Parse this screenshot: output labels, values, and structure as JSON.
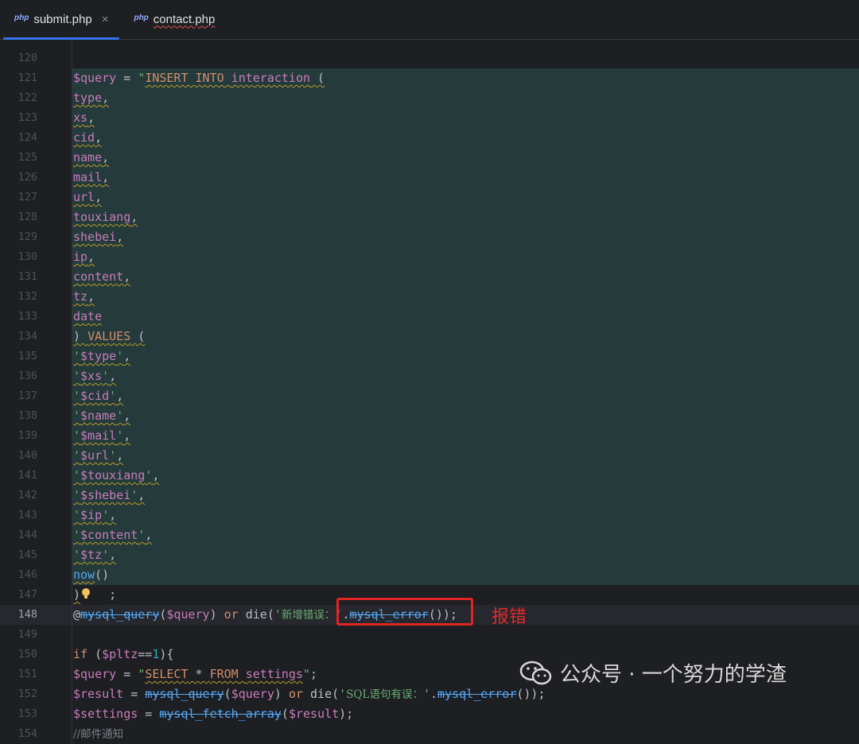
{
  "tabs": [
    {
      "icon_text": "php",
      "label": "submit.php",
      "active": true,
      "close": "×"
    },
    {
      "icon_text": "php",
      "label": "contact.php",
      "active": false
    }
  ],
  "lines": [
    {
      "n": "120",
      "tokens": []
    },
    {
      "n": "121",
      "tokens": [
        [
          "var",
          "$query"
        ],
        [
          "plain",
          " = "
        ],
        [
          "str",
          "\""
        ],
        [
          "sqlkw sq",
          "INSERT INTO"
        ],
        [
          "plain sq",
          " "
        ],
        [
          "sqlid sq",
          "interaction"
        ],
        [
          "plain sq",
          " ("
        ]
      ]
    },
    {
      "n": "122",
      "tokens": [
        [
          "sqlid sq",
          "type"
        ],
        [
          "plain sq",
          ","
        ]
      ]
    },
    {
      "n": "123",
      "tokens": [
        [
          "sqlid sq",
          "xs"
        ],
        [
          "plain sq",
          ","
        ]
      ]
    },
    {
      "n": "124",
      "tokens": [
        [
          "sqlid sq",
          "cid"
        ],
        [
          "plain sq",
          ","
        ]
      ]
    },
    {
      "n": "125",
      "tokens": [
        [
          "sqlid sq",
          "name"
        ],
        [
          "plain sq",
          ","
        ]
      ]
    },
    {
      "n": "126",
      "tokens": [
        [
          "sqlid sq",
          "mail"
        ],
        [
          "plain sq",
          ","
        ]
      ]
    },
    {
      "n": "127",
      "tokens": [
        [
          "sqlid sq",
          "url"
        ],
        [
          "plain sq",
          ","
        ]
      ]
    },
    {
      "n": "128",
      "tokens": [
        [
          "sqlid sq",
          "touxiang"
        ],
        [
          "plain sq",
          ","
        ]
      ]
    },
    {
      "n": "129",
      "tokens": [
        [
          "sqlid sq",
          "shebei"
        ],
        [
          "plain sq",
          ","
        ]
      ]
    },
    {
      "n": "130",
      "tokens": [
        [
          "sqlid sq",
          "ip"
        ],
        [
          "plain sq",
          ","
        ]
      ]
    },
    {
      "n": "131",
      "tokens": [
        [
          "sqlid sq",
          "content"
        ],
        [
          "plain sq",
          ","
        ]
      ]
    },
    {
      "n": "132",
      "tokens": [
        [
          "sqlid sq",
          "tz"
        ],
        [
          "plain sq",
          ","
        ]
      ]
    },
    {
      "n": "133",
      "tokens": [
        [
          "sqlid sq",
          "date"
        ]
      ]
    },
    {
      "n": "134",
      "tokens": [
        [
          "plain sq",
          ") "
        ],
        [
          "sqlkw sq",
          "VALUES"
        ],
        [
          "plain sq",
          " ("
        ]
      ]
    },
    {
      "n": "135",
      "tokens": [
        [
          "str sq",
          "'"
        ],
        [
          "var sq",
          "$type"
        ],
        [
          "str sq",
          "'"
        ],
        [
          "plain sq",
          ","
        ]
      ]
    },
    {
      "n": "136",
      "tokens": [
        [
          "str sq",
          "'"
        ],
        [
          "var sq",
          "$xs"
        ],
        [
          "str sq",
          "'"
        ],
        [
          "plain sq",
          ","
        ]
      ]
    },
    {
      "n": "137",
      "tokens": [
        [
          "str sq",
          "'"
        ],
        [
          "var sq",
          "$cid"
        ],
        [
          "str sq",
          "'"
        ],
        [
          "plain sq",
          ","
        ]
      ]
    },
    {
      "n": "138",
      "tokens": [
        [
          "str sq",
          "'"
        ],
        [
          "var sq",
          "$name"
        ],
        [
          "str sq",
          "'"
        ],
        [
          "plain sq",
          ","
        ]
      ]
    },
    {
      "n": "139",
      "tokens": [
        [
          "str sq",
          "'"
        ],
        [
          "var sq",
          "$mail"
        ],
        [
          "str sq",
          "'"
        ],
        [
          "plain sq",
          ","
        ]
      ]
    },
    {
      "n": "140",
      "tokens": [
        [
          "str sq",
          "'"
        ],
        [
          "var sq",
          "$url"
        ],
        [
          "str sq",
          "'"
        ],
        [
          "plain sq",
          ","
        ]
      ]
    },
    {
      "n": "141",
      "tokens": [
        [
          "str sq",
          "'"
        ],
        [
          "var sq",
          "$touxiang"
        ],
        [
          "str sq",
          "'"
        ],
        [
          "plain sq",
          ","
        ]
      ]
    },
    {
      "n": "142",
      "tokens": [
        [
          "str sq",
          "'"
        ],
        [
          "var sq",
          "$shebei"
        ],
        [
          "str sq",
          "'"
        ],
        [
          "plain sq",
          ","
        ]
      ]
    },
    {
      "n": "143",
      "tokens": [
        [
          "str sq",
          "'"
        ],
        [
          "var sq",
          "$ip"
        ],
        [
          "str sq",
          "'"
        ],
        [
          "plain sq",
          ","
        ]
      ]
    },
    {
      "n": "144",
      "tokens": [
        [
          "str sq",
          "'"
        ],
        [
          "var sq",
          "$content"
        ],
        [
          "str sq",
          "'"
        ],
        [
          "plain sq",
          ","
        ]
      ]
    },
    {
      "n": "145",
      "tokens": [
        [
          "str sq",
          "'"
        ],
        [
          "var sq",
          "$tz"
        ],
        [
          "str sq",
          "'"
        ],
        [
          "plain sq",
          ","
        ]
      ]
    },
    {
      "n": "146",
      "tokens": [
        [
          "fn sq",
          "now"
        ],
        [
          "plain",
          "()"
        ]
      ]
    },
    {
      "n": "147",
      "tokens": [
        [
          "plain sq",
          ")"
        ],
        [
          "plain",
          "    ;"
        ]
      ]
    },
    {
      "n": "148",
      "tokens": [
        [
          "plain",
          "@"
        ],
        [
          "fn-dep",
          "mysql_query"
        ],
        [
          "plain",
          "("
        ],
        [
          "var",
          "$query"
        ],
        [
          "plain",
          ") "
        ],
        [
          "kw",
          "or"
        ],
        [
          "plain",
          " die("
        ],
        [
          "str",
          "'"
        ],
        [
          "str cjk",
          "新增错误："
        ],
        [
          "str",
          "'"
        ],
        [
          "plain",
          "."
        ],
        [
          "fn-dep",
          "mysql_error"
        ],
        [
          "plain",
          "());"
        ]
      ]
    },
    {
      "n": "149",
      "tokens": []
    },
    {
      "n": "150",
      "tokens": [
        [
          "kw",
          "if"
        ],
        [
          "plain",
          " ("
        ],
        [
          "var",
          "$pltz"
        ],
        [
          "plain",
          "=="
        ],
        [
          "num",
          "1"
        ],
        [
          "plain",
          "){"
        ]
      ]
    },
    {
      "n": "151",
      "tokens": [
        [
          "var",
          "$query"
        ],
        [
          "plain",
          " = "
        ],
        [
          "str",
          "\""
        ],
        [
          "sqlkw sq",
          "SELECT"
        ],
        [
          "plain sq",
          " * "
        ],
        [
          "sqlkw sq",
          "FROM"
        ],
        [
          "plain sq",
          " "
        ],
        [
          "sqlid sq",
          "settings"
        ],
        [
          "str",
          "\""
        ],
        [
          "plain",
          ";"
        ]
      ]
    },
    {
      "n": "152",
      "tokens": [
        [
          "var",
          "$result"
        ],
        [
          "plain",
          " = "
        ],
        [
          "fn-dep",
          "mysql_query"
        ],
        [
          "plain",
          "("
        ],
        [
          "var",
          "$query"
        ],
        [
          "plain",
          ") "
        ],
        [
          "kw",
          "or"
        ],
        [
          "plain",
          " die("
        ],
        [
          "str",
          "'"
        ],
        [
          "str cjk",
          "SQL语句有误："
        ],
        [
          "str",
          "'"
        ],
        [
          "plain",
          "."
        ],
        [
          "fn-dep",
          "mysql_error"
        ],
        [
          "plain",
          "());"
        ]
      ]
    },
    {
      "n": "153",
      "tokens": [
        [
          "var",
          "$settings"
        ],
        [
          "plain",
          " = "
        ],
        [
          "fn-dep",
          "mysql_fetch_array"
        ],
        [
          "plain",
          "("
        ],
        [
          "var",
          "$result"
        ],
        [
          "plain",
          ");"
        ]
      ]
    },
    {
      "n": "154",
      "tokens": [
        [
          "cmt",
          "//邮件通知"
        ]
      ]
    }
  ],
  "annotation": {
    "text": "报错",
    "color": "#e02a2a"
  },
  "watermark": {
    "text": "公众号 · 一个努力的学渣",
    "icon": "wechat-icon"
  },
  "colors": {
    "accent": "#3574f0",
    "background": "#1e1f22",
    "highlight": "#253a3b"
  }
}
